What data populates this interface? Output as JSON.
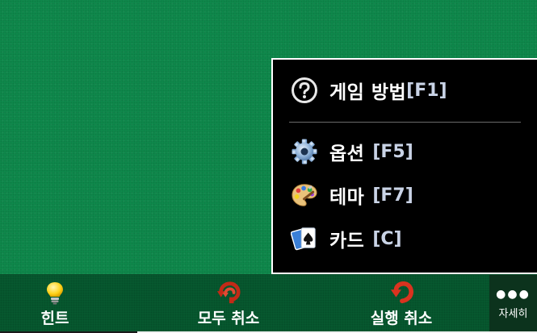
{
  "menu": {
    "items": [
      {
        "label": "게임 방법",
        "shortcut": "[F1]",
        "icon": "help-circle-icon"
      },
      {
        "label": "옵션",
        "shortcut": "[F5]",
        "icon": "gear-icon"
      },
      {
        "label": "테마",
        "shortcut": "[F7]",
        "icon": "palette-icon"
      },
      {
        "label": "카드",
        "shortcut": "[C]",
        "icon": "cards-icon"
      }
    ]
  },
  "bottombar": {
    "hint_label": "힌트",
    "undo_all_label": "모두 취소",
    "undo_label": "실행 취소",
    "more_label": "자세히",
    "more_glyph": "●●●"
  },
  "colors": {
    "felt": "#0e8a4c",
    "bar": "#075a30",
    "menu_bg": "#000000",
    "shortcut_text": "#c9d3e6",
    "undo_arrow": "#d9331f"
  }
}
